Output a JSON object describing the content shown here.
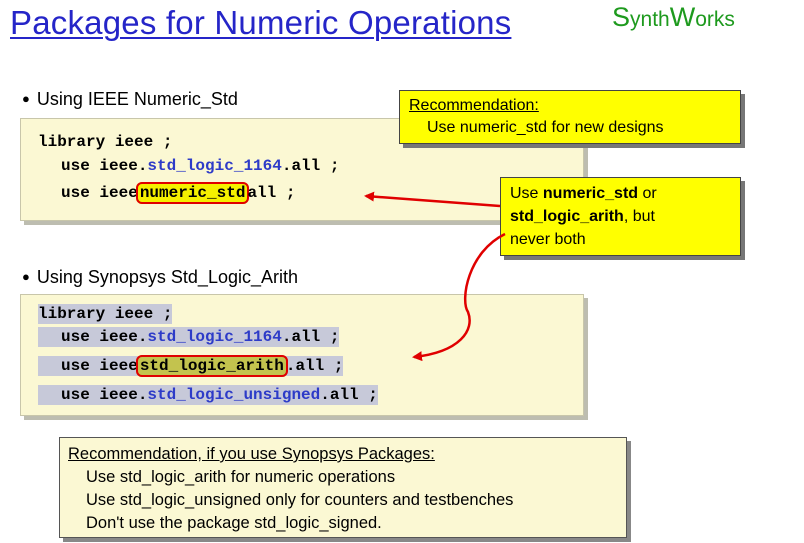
{
  "title": "Packages for Numeric Operations",
  "logo": {
    "part1_big": "S",
    "part1_rest": "ynth",
    "part2_big": "W",
    "part2_rest": "orks"
  },
  "section_numeric": {
    "bullet": "Using IEEE Numeric_Std",
    "code": {
      "line1": "library ieee ;",
      "line2_prefix": "use ieee.",
      "line2_pkg": "std_logic_1164",
      "line2_suffix": ".all ;",
      "line3_prefix": "use ieee",
      "line3_pkg": "numeric_std",
      "line3_suffix": "all ;"
    }
  },
  "section_synopsys": {
    "bullet": "Using Synopsys Std_Logic_Arith",
    "code": {
      "line1": "library ieee ;",
      "line2_prefix": "use ieee.",
      "line2_pkg": "std_logic_1164",
      "line2_suffix": ".all ;",
      "line3_prefix": "use ieee",
      "line3_pkg": "std_logic_arith",
      "line3_suffix": ".all ;",
      "line4_prefix": "use ieee.",
      "line4_pkg": "std_logic_unsigned",
      "line4_suffix": ".all ;"
    }
  },
  "recommendation_top": {
    "heading": "Recommendation:",
    "body": "Use numeric_std for new designs"
  },
  "callout_both": {
    "pre": "Use ",
    "bold1": "numeric_std",
    "mid": " or",
    "bold2": "std_logic_arith",
    "post": ", but",
    "line3": "never both"
  },
  "recommendation_bottom": {
    "heading": "Recommendation, if you use Synopsys Packages:",
    "items": [
      "Use std_logic_arith for numeric operations",
      "Use std_logic_unsigned only for counters and testbenches",
      "Don't use the package std_logic_signed."
    ]
  },
  "colors": {
    "title": "#2525c8",
    "logo": "#1e9a1e",
    "callout_fill": "#ffff00",
    "code_box_fill": "#fbf8d3",
    "arrow": "#e00000",
    "package_name": "#2d3bc8"
  }
}
